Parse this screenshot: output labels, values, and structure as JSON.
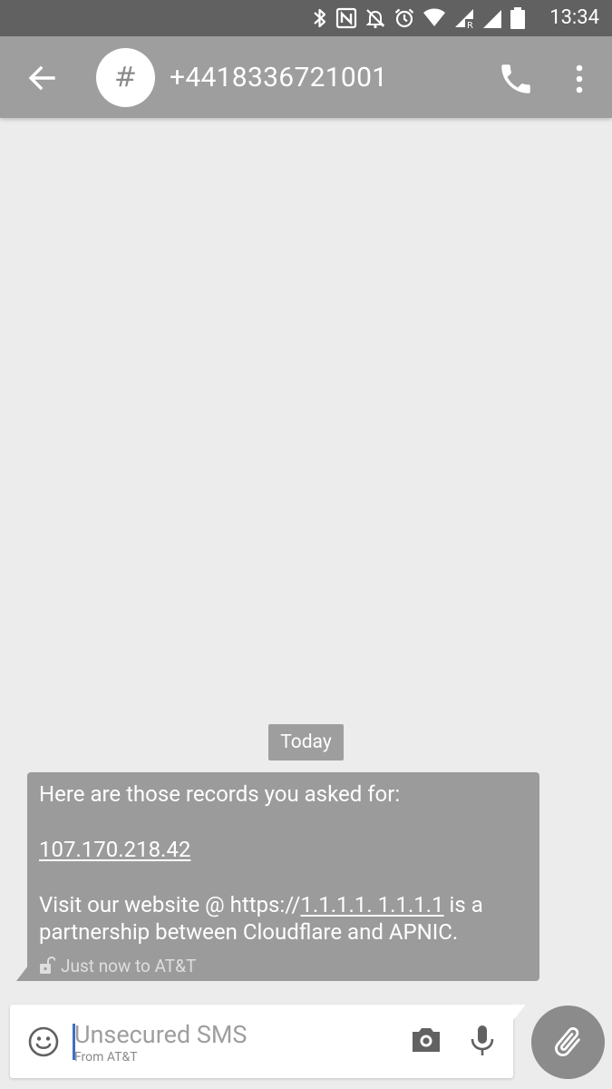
{
  "status_bar": {
    "time": "13:34",
    "icons": [
      "bluetooth-icon",
      "nfc-icon",
      "notifications-off-icon",
      "alarm-icon",
      "wifi-icon",
      "signal-roaming-icon",
      "signal-icon",
      "battery-icon"
    ]
  },
  "app_bar": {
    "back_icon": "arrow-back-icon",
    "avatar_glyph": "#",
    "title": "+4418336721001",
    "call_icon": "phone-icon",
    "more_icon": "more-vert-icon"
  },
  "conversation": {
    "date_label": "Today",
    "message": {
      "line1": "Here are those records you asked for:",
      "ip": "107.170.218.42",
      "line3_prefix": "Visit our website @ https://",
      "line3_link": "1.1.1.1. 1.1.1.1",
      "line3_suffix": " is a",
      "line4": "partnership between Cloudflare and APNIC.",
      "meta_icon": "unlocked-icon",
      "meta": "Just now to AT&T"
    }
  },
  "compose": {
    "emoji_icon": "emoji-icon",
    "placeholder": "Unsecured SMS",
    "sub_label": "From AT&T",
    "camera_icon": "camera-icon",
    "mic_icon": "mic-icon",
    "attach_icon": "attach-icon"
  },
  "colors": {
    "status_bar": "#616161",
    "app_bar": "#9e9e9e",
    "background": "#ececec",
    "bubble": "#9b9b9b",
    "fab": "#8b8b8b",
    "cursor": "#3f6ec8"
  }
}
